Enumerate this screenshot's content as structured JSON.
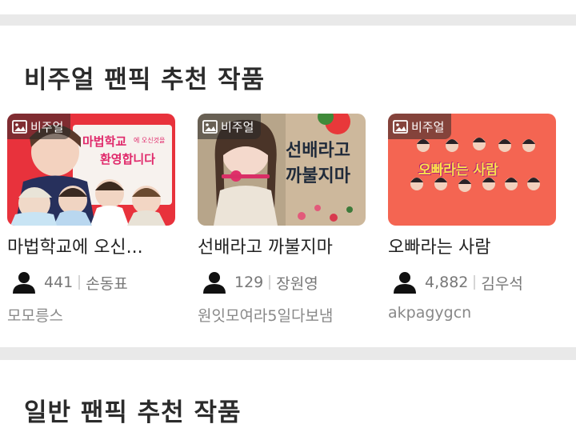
{
  "section1": {
    "title": "비주얼 팬픽 추천 작품",
    "cards": [
      {
        "badge": "비주얼",
        "thumb_text_1": "마법학교",
        "thumb_text_2": "에 오신것을",
        "thumb_text_3": "환영합니다",
        "title": "마법학교에 오신...",
        "count": "441",
        "author": "손동표",
        "subauthor": "모모릉스",
        "bg_color": "#e8323c"
      },
      {
        "badge": "비주얼",
        "thumb_text_1": "선배라고",
        "thumb_text_2": "까불지마",
        "title": "선배라고 까불지마",
        "count": "129",
        "author": "장원영",
        "subauthor": "원잇모여라5일다보냄",
        "bg_color": "#ccb79a"
      },
      {
        "badge": "비주얼",
        "thumb_text_1": "오빠라는 사람",
        "title": "오빠라는 사람",
        "count": "4,882",
        "author": "김우석",
        "subauthor": "akpagygcn",
        "bg_color": "#f46552"
      }
    ]
  },
  "section2": {
    "title": "일반 팬픽 추천 작품"
  }
}
